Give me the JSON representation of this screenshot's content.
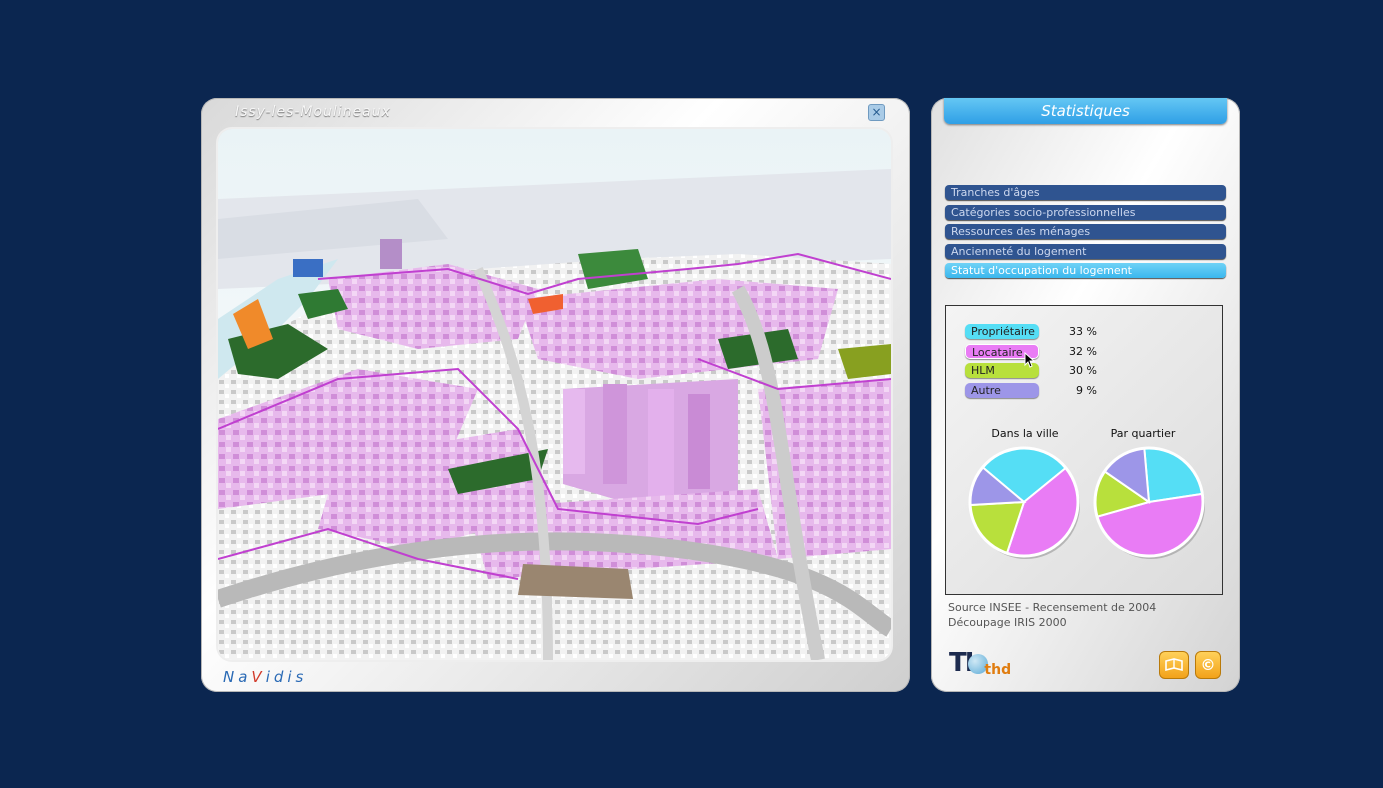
{
  "map_window": {
    "title": "Issy-les-Moulineaux",
    "close_symbol": "×",
    "brand_left": "Na",
    "brand_v": "V",
    "brand_right": "idis"
  },
  "stats_panel": {
    "title": "Statistiques",
    "menu": [
      {
        "label": "Tranches d'âges",
        "active": false
      },
      {
        "label": "Catégories socio-professionnelles",
        "active": false
      },
      {
        "label": "Ressources des ménages",
        "active": false
      },
      {
        "label": "Ancienneté du logement",
        "active": false
      },
      {
        "label": "Statut d'occupation du logement",
        "active": true
      }
    ],
    "legend": [
      {
        "label": "Propriétaire",
        "value": "33 %",
        "color": "#55def5"
      },
      {
        "label": "Locataire",
        "value": "32 %",
        "color": "#e97cf5"
      },
      {
        "label": "HLM",
        "value": "30 %",
        "color": "#b8e03c"
      },
      {
        "label": "Autre",
        "value": "9 %",
        "color": "#9d96e8"
      }
    ],
    "pie_city_label": "Dans la ville",
    "pie_quarter_label": "Par quartier",
    "source_line1": "Source INSEE - Recensement de 2004",
    "source_line2": "Découpage IRIS 2000",
    "logo_text": "TI",
    "logo_suffix": "thd",
    "icons": {
      "book": "book-icon",
      "copyright": "copyright-icon"
    },
    "copyright_symbol": "©"
  },
  "chart_data": [
    {
      "type": "pie",
      "title": "Dans la ville",
      "categories": [
        "Propriétaire",
        "Locataire",
        "HLM",
        "Autre"
      ],
      "values": [
        28,
        41,
        19,
        12
      ],
      "colors": [
        "#55def5",
        "#e97cf5",
        "#b8e03c",
        "#9d96e8"
      ]
    },
    {
      "type": "pie",
      "title": "Par quartier",
      "categories": [
        "Propriétaire",
        "Locataire",
        "HLM",
        "Autre"
      ],
      "values": [
        24,
        48,
        14,
        14
      ],
      "colors": [
        "#55def5",
        "#e97cf5",
        "#b8e03c",
        "#9d96e8"
      ]
    }
  ]
}
